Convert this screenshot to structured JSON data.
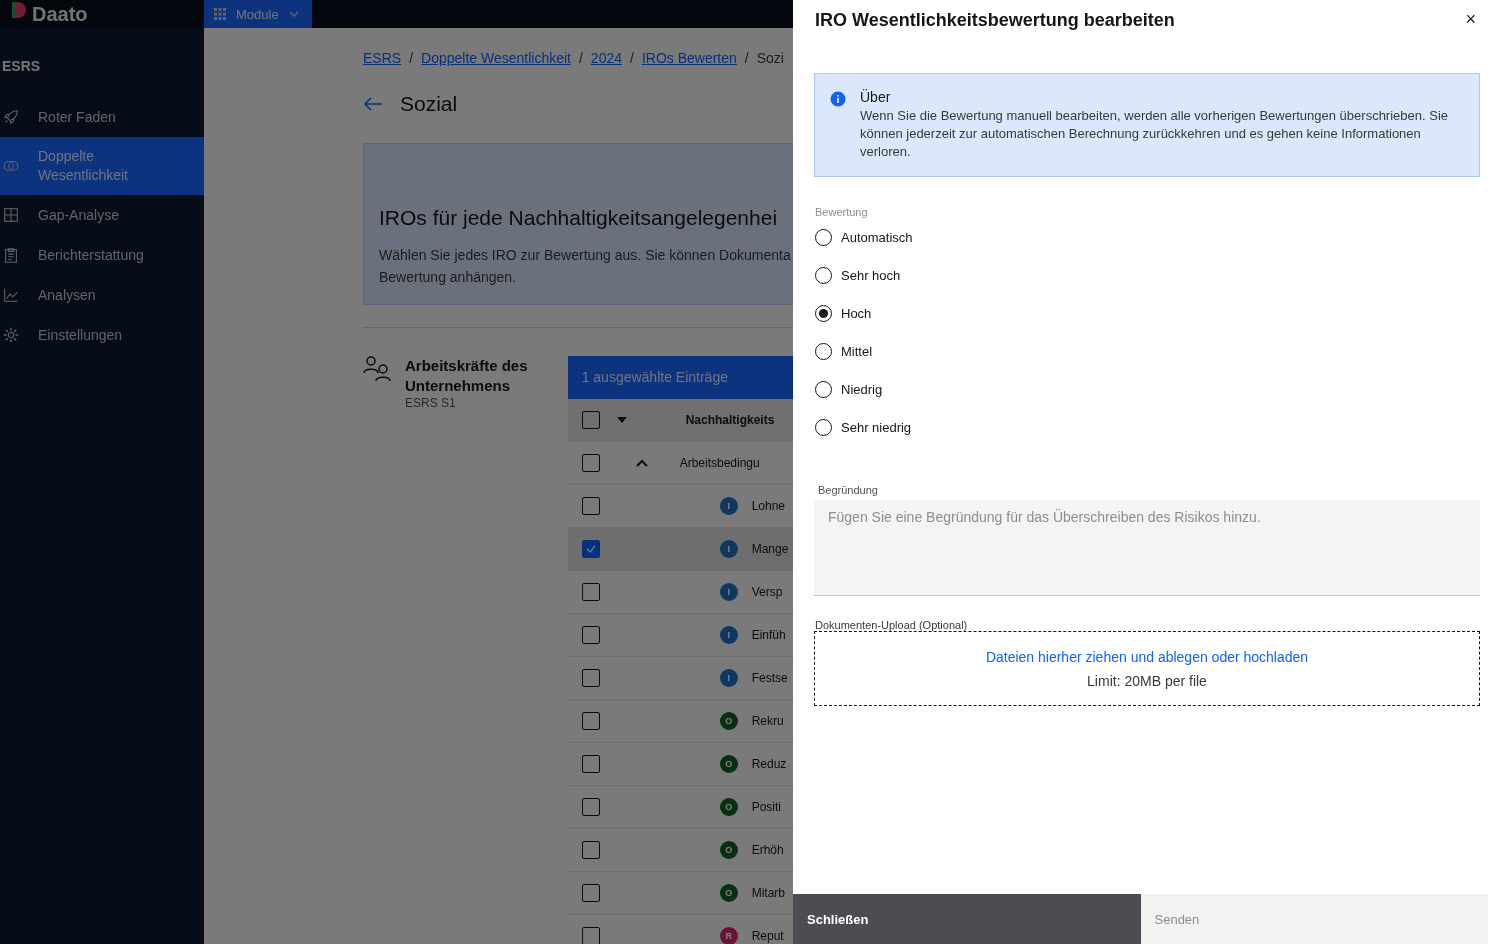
{
  "app": {
    "logo": "Daato",
    "module_button": "Module"
  },
  "sidebar": {
    "section": "ESRS",
    "items": [
      {
        "label": "Roter Faden",
        "selected": false
      },
      {
        "label": "Doppelte Wesentlichkeit",
        "selected": true
      },
      {
        "label": "Gap-Analyse",
        "selected": false
      },
      {
        "label": "Berichterstattung",
        "selected": false
      },
      {
        "label": "Analysen",
        "selected": false
      },
      {
        "label": "Einstellungen",
        "selected": false
      }
    ]
  },
  "breadcrumbs": [
    {
      "label": "ESRS",
      "link": true
    },
    {
      "separator": "/",
      "label": "Doppelte Wesentlichkeit",
      "link": true
    },
    {
      "separator": "/",
      "label": "2024",
      "link": true
    },
    {
      "separator": "/",
      "label": "IROs Bewerten",
      "link": true
    },
    {
      "separator": "/",
      "label": "Sozi",
      "link": false
    }
  ],
  "page_title": "Sozial",
  "banner": {
    "title": "IROs für jede Nachhaltigkeitsangelegenhei",
    "text": "Wählen Sie jedes IRO zur Bewertung aus. Sie können Dokumenta\nBewertung anhängen."
  },
  "section": {
    "title": "Arbeitskräfte des Unternehmens",
    "code": "ESRS S1"
  },
  "table": {
    "selection_bar": "1 ausgewählte Einträge",
    "header": {
      "label": "Nachhaltigkeits",
      "checked": false
    },
    "group": {
      "label": "Arbeitsbedingu",
      "checked": false,
      "expanded": true
    },
    "rows": [
      {
        "kind": "impact",
        "badge": "I",
        "label": "Lohne",
        "checked": false
      },
      {
        "kind": "impact",
        "badge": "I",
        "label": "Mange",
        "checked": true
      },
      {
        "kind": "impact",
        "badge": "I",
        "label": "Versp",
        "checked": false
      },
      {
        "kind": "impact",
        "badge": "I",
        "label": "Einfüh",
        "checked": false
      },
      {
        "kind": "impact",
        "badge": "I",
        "label": "Festse",
        "checked": false
      },
      {
        "kind": "opportunity",
        "badge": "O",
        "label": "Rekru",
        "checked": false
      },
      {
        "kind": "opportunity",
        "badge": "O",
        "label": "Reduz",
        "checked": false
      },
      {
        "kind": "opportunity",
        "badge": "O",
        "label": "Positi",
        "checked": false
      },
      {
        "kind": "opportunity",
        "badge": "O",
        "label": "Erhöh",
        "checked": false
      },
      {
        "kind": "opportunity",
        "badge": "O",
        "label": "Mitarb",
        "checked": false
      },
      {
        "kind": "risk",
        "badge": "R",
        "label": "Reput",
        "checked": false
      }
    ]
  },
  "panel": {
    "title": "IRO Wesentlichkeitsbewertung bearbeiten",
    "close": "×",
    "notice": {
      "title": "Über",
      "text": "Wenn Sie die Bewertung manuell bearbeiten, werden alle vorherigen Bewertungen überschrieben. Sie können jederzeit zur automatischen Berechnung zurückkehren und es gehen keine Informationen verloren."
    },
    "rating_label": "Bewertung",
    "options": [
      {
        "label": "Automatisch",
        "selected": false
      },
      {
        "label": "Sehr hoch",
        "selected": false
      },
      {
        "label": "Hoch",
        "selected": true
      },
      {
        "label": "Mittel",
        "selected": false
      },
      {
        "label": "Niedrig",
        "selected": false
      },
      {
        "label": "Sehr niedrig",
        "selected": false
      }
    ],
    "reason_label": "Begründung",
    "reason_placeholder": "Fügen Sie eine Begründung für das Überschreiben des Risikos hinzu.",
    "upload_label": "Dokumenten-Upload (Optional)",
    "upload_link": "Dateien hierher ziehen und ablegen oder hochladen",
    "upload_limit": "Limit: 20MB per file",
    "buttons": [
      {
        "label": "Schließen",
        "disabled": false
      },
      {
        "label": "Senden",
        "disabled": true
      }
    ]
  }
}
